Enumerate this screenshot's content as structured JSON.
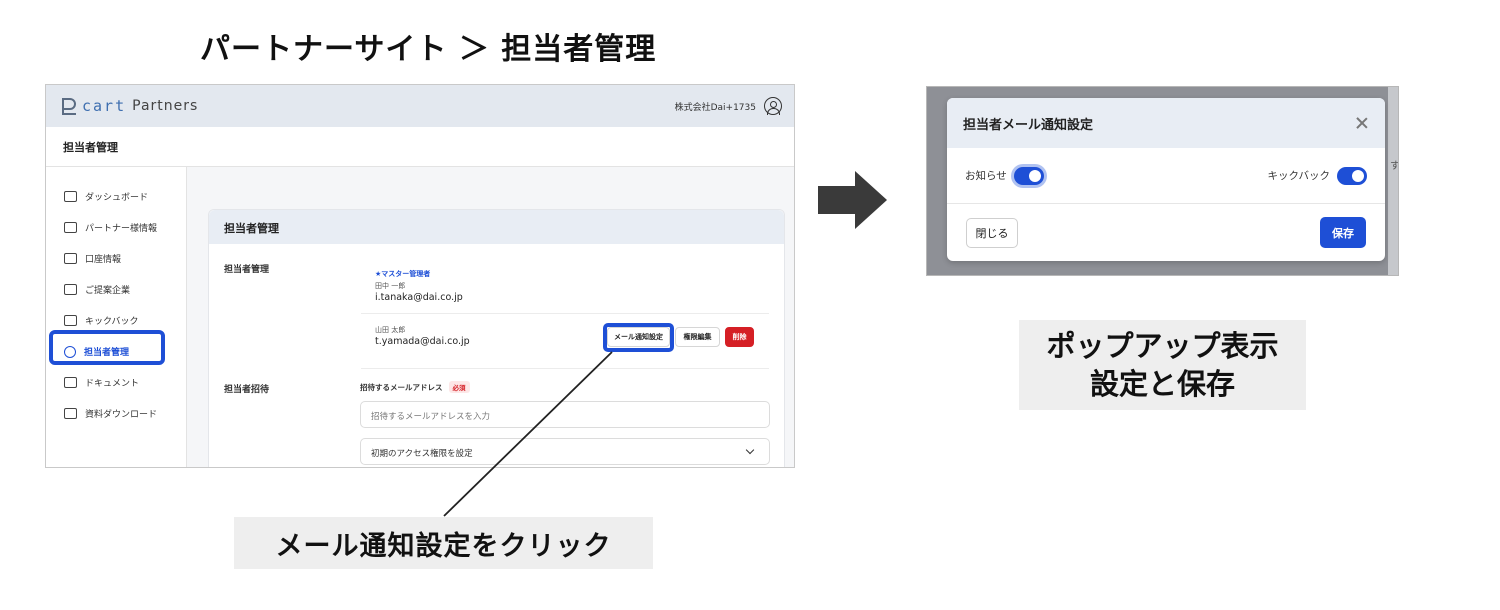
{
  "main_title": "パートナーサイト ＞ 担当者管理",
  "app": {
    "logo_cart": "cart",
    "logo_partners": "Partners",
    "company": "株式会社Dai+1735",
    "page_title": "担当者管理",
    "sidebar": {
      "items": [
        {
          "label": "ダッシュボード",
          "icon": "home-icon"
        },
        {
          "label": "パートナー様情報",
          "icon": "id-card-icon"
        },
        {
          "label": "口座情報",
          "icon": "bank-icon"
        },
        {
          "label": "ご提案企業",
          "icon": "companies-icon"
        },
        {
          "label": "キックバック",
          "icon": "money-icon"
        },
        {
          "label": "担当者管理",
          "icon": "users-icon"
        },
        {
          "label": "ドキュメント",
          "icon": "book-icon"
        },
        {
          "label": "資料ダウンロード",
          "icon": "download-icon"
        }
      ]
    },
    "card": {
      "title": "担当者管理",
      "section_label": "担当者管理",
      "users": [
        {
          "tag": "★マスター管理者",
          "name": "田中 一郎",
          "email": "i.tanaka@dai.co.jp"
        },
        {
          "name": "山田 太郎",
          "email": "t.yamada@dai.co.jp"
        }
      ],
      "buttons": {
        "mail_settings": "メール通知設定",
        "edit_perm": "権限編集",
        "delete": "削除"
      },
      "invite": {
        "label": "担当者招待",
        "field_label": "招待するメールアドレス",
        "required": "必須",
        "email_placeholder": "招待するメールアドレスを入力",
        "access_select": "初期のアクセス権限を設定"
      }
    }
  },
  "caption_left": "メール通知設定をクリック",
  "modal": {
    "title": "担当者メール通知設定",
    "toggle_notice": "お知らせ",
    "toggle_kickback": "キックバック",
    "close_button": "閉じる",
    "save_button": "保存",
    "bg_peek": "す"
  },
  "caption_right": {
    "line1": "ポップアップ表示",
    "line2": "設定と保存"
  },
  "colors": {
    "accent": "#1e4fd6",
    "danger": "#d51f25",
    "header_bg": "#e3e8ef"
  }
}
